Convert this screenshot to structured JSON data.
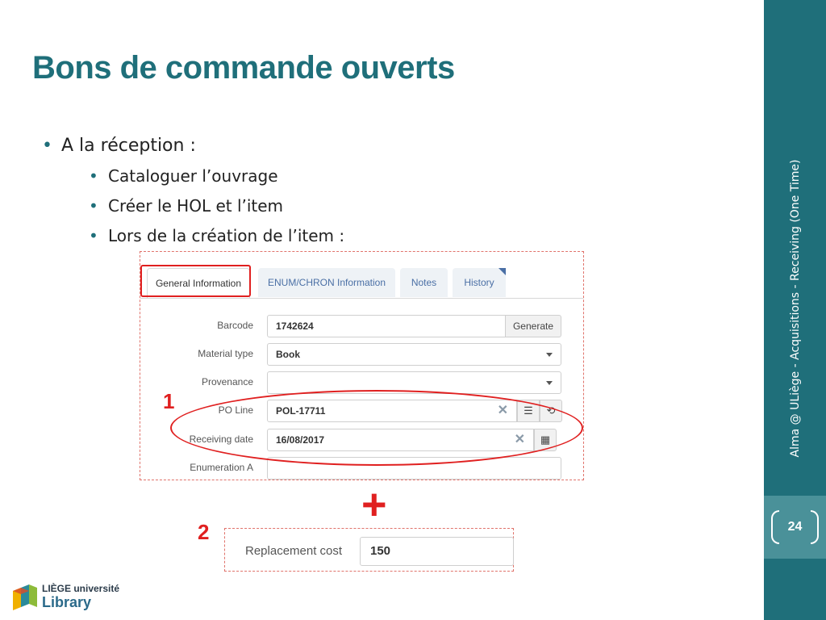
{
  "slide": {
    "title": "Bons de commande ouverts",
    "bullet_main": "A la réception :",
    "sub_bullets": [
      "Cataloguer l’ouvrage",
      "Créer le HOL et l’item",
      "Lors de la création de l’item :"
    ],
    "page_number": "24",
    "sidebar_text": "Alma @ ULiège - Acquisitions - Receiving (One Time)"
  },
  "markers": {
    "one": "1",
    "two": "2",
    "plus": "+"
  },
  "tabs": [
    "General Information",
    "ENUM/CHRON Information",
    "Notes",
    "History"
  ],
  "form": {
    "barcode_label": "Barcode",
    "barcode_value": "1742624",
    "generate_label": "Generate",
    "material_type_label": "Material type",
    "material_type_value": "Book",
    "provenance_label": "Provenance",
    "provenance_value": "",
    "po_line_label": "PO Line",
    "po_line_value": "POL-17711",
    "receiving_date_label": "Receiving date",
    "receiving_date_value": "16/08/2017",
    "enumeration_a_label": "Enumeration A",
    "enumeration_a_value": ""
  },
  "replacement": {
    "label": "Replacement cost",
    "value": "150"
  },
  "logo": {
    "line1": "LIÈGE université",
    "line2": "Library"
  },
  "colors": {
    "accent": "#1f6f7a",
    "highlight": "#e02020",
    "sidebar_band": "#4a9199"
  }
}
